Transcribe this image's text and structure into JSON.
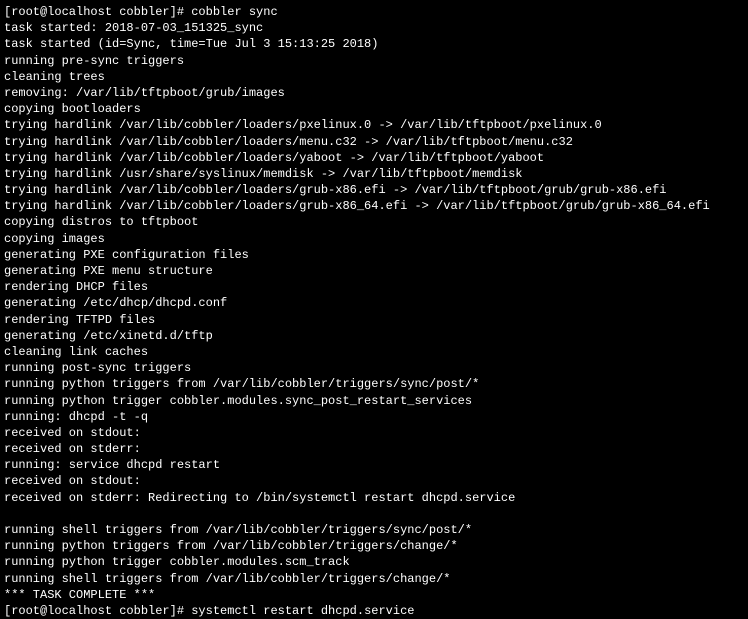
{
  "prompt1": "[root@localhost cobbler]# ",
  "command1": "cobbler sync",
  "lines": [
    "task started: 2018-07-03_151325_sync",
    "task started (id=Sync, time=Tue Jul  3 15:13:25 2018)",
    "running pre-sync triggers",
    "cleaning trees",
    "removing: /var/lib/tftpboot/grub/images",
    "copying bootloaders",
    "trying hardlink /var/lib/cobbler/loaders/pxelinux.0 -> /var/lib/tftpboot/pxelinux.0",
    "trying hardlink /var/lib/cobbler/loaders/menu.c32 -> /var/lib/tftpboot/menu.c32",
    "trying hardlink /var/lib/cobbler/loaders/yaboot -> /var/lib/tftpboot/yaboot",
    "trying hardlink /usr/share/syslinux/memdisk -> /var/lib/tftpboot/memdisk",
    "trying hardlink /var/lib/cobbler/loaders/grub-x86.efi -> /var/lib/tftpboot/grub/grub-x86.efi",
    "trying hardlink /var/lib/cobbler/loaders/grub-x86_64.efi -> /var/lib/tftpboot/grub/grub-x86_64.efi",
    "copying distros to tftpboot",
    "copying images",
    "generating PXE configuration files",
    "generating PXE menu structure",
    "rendering DHCP files",
    "generating /etc/dhcp/dhcpd.conf",
    "rendering TFTPD files",
    "generating /etc/xinetd.d/tftp",
    "cleaning link caches",
    "running post-sync triggers",
    "running python triggers from /var/lib/cobbler/triggers/sync/post/*",
    "running python trigger cobbler.modules.sync_post_restart_services",
    "running: dhcpd -t -q",
    "received on stdout:",
    "received on stderr:",
    "running: service dhcpd restart",
    "received on stdout:",
    "received on stderr: Redirecting to /bin/systemctl restart  dhcpd.service",
    "",
    "running shell triggers from /var/lib/cobbler/triggers/sync/post/*",
    "running python triggers from /var/lib/cobbler/triggers/change/*",
    "running python trigger cobbler.modules.scm_track",
    "running shell triggers from /var/lib/cobbler/triggers/change/*",
    "*** TASK COMPLETE ***"
  ],
  "prompt2": "[root@localhost cobbler]# ",
  "command2": "systemctl restart dhcpd.service"
}
